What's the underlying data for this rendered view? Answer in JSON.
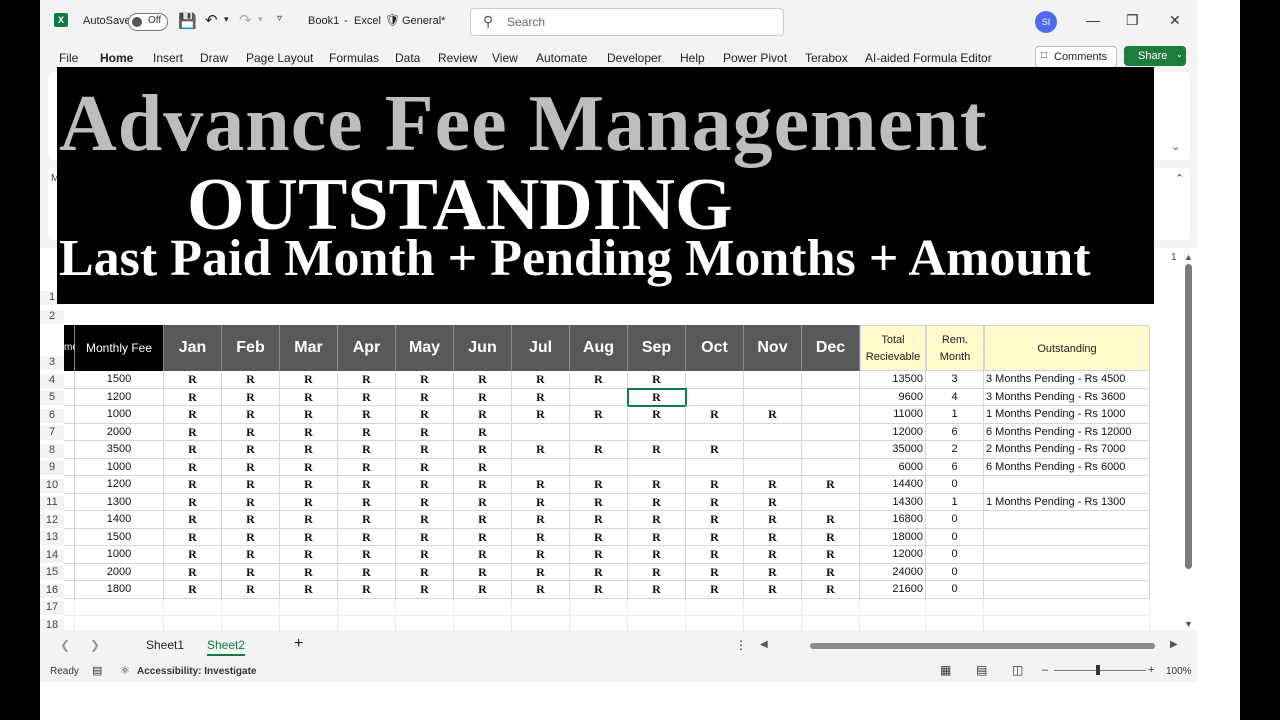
{
  "titlebar": {
    "autosave_label": "AutoSave",
    "autosave_state": "Off",
    "doc_title": "Book1",
    "app": "Excel",
    "sensitivity": "General*",
    "search_placeholder": "Search",
    "user_initials": "SI"
  },
  "menu": {
    "tabs": [
      "File",
      "Home",
      "Insert",
      "Draw",
      "Page Layout",
      "Formulas",
      "Data",
      "Review",
      "View",
      "Automate",
      "Developer",
      "Help",
      "Power Pivot",
      "Terabox",
      "AI-aided Formula Editor"
    ],
    "active": "Home",
    "comments_label": "Comments",
    "share_label": "Share"
  },
  "banner": {
    "line1": "Advance Fee Management",
    "line2": "OUTSTANDING",
    "line3": "Last Paid Month + Pending Months + Amount"
  },
  "table": {
    "row_numbers": [
      "1",
      "2",
      "3",
      "4",
      "5",
      "6",
      "7",
      "8",
      "9",
      "10",
      "11",
      "12",
      "13",
      "14",
      "15",
      "16",
      "17",
      "18"
    ],
    "clipped_header": "me",
    "fee_header": "Monthly Fee",
    "months": [
      "Jan",
      "Feb",
      "Mar",
      "Apr",
      "May",
      "Jun",
      "Jul",
      "Aug",
      "Sep",
      "Oct",
      "Nov",
      "Dec"
    ],
    "total_header": "Total Recievable",
    "rem_header": "Rem. Month",
    "outstanding_header": "Outstanding",
    "rows": [
      {
        "fee": "1500",
        "paid": 9,
        "total": "13500",
        "rem": "3",
        "out": "3 Months Pending - Rs 4500"
      },
      {
        "fee": "1200",
        "paid": 7,
        "total": "9600",
        "rem": "4",
        "out": "3 Months Pending - Rs 3600",
        "extra_sep": true
      },
      {
        "fee": "1000",
        "paid": 11,
        "total": "11000",
        "rem": "1",
        "out": "1 Months Pending - Rs 1000"
      },
      {
        "fee": "2000",
        "paid": 6,
        "total": "12000",
        "rem": "6",
        "out": "6 Months Pending - Rs 12000"
      },
      {
        "fee": "3500",
        "paid": 10,
        "total": "35000",
        "rem": "2",
        "out": "2 Months Pending - Rs 7000"
      },
      {
        "fee": "1000",
        "paid": 6,
        "total": "6000",
        "rem": "6",
        "out": "6 Months Pending - Rs 6000"
      },
      {
        "fee": "1200",
        "paid": 12,
        "total": "14400",
        "rem": "0",
        "out": ""
      },
      {
        "fee": "1300",
        "paid": 11,
        "total": "14300",
        "rem": "1",
        "out": "1 Months Pending - Rs 1300"
      },
      {
        "fee": "1400",
        "paid": 12,
        "total": "16800",
        "rem": "0",
        "out": ""
      },
      {
        "fee": "1500",
        "paid": 12,
        "total": "18000",
        "rem": "0",
        "out": ""
      },
      {
        "fee": "1000",
        "paid": 12,
        "total": "12000",
        "rem": "0",
        "out": ""
      },
      {
        "fee": "2000",
        "paid": 12,
        "total": "24000",
        "rem": "0",
        "out": ""
      },
      {
        "fee": "1800",
        "paid": 12,
        "total": "21600",
        "rem": "0",
        "out": ""
      }
    ],
    "paid_mark": "R"
  },
  "sheets": {
    "tabs": [
      "Sheet1",
      "Sheet2"
    ],
    "active": "Sheet2"
  },
  "status": {
    "ready": "Ready",
    "accessibility": "Accessibility: Investigate",
    "zoom": "100%"
  },
  "colors": {
    "excel_green": "#107c41",
    "header_grey": "#595959",
    "header_yellow": "#fff9cc"
  }
}
